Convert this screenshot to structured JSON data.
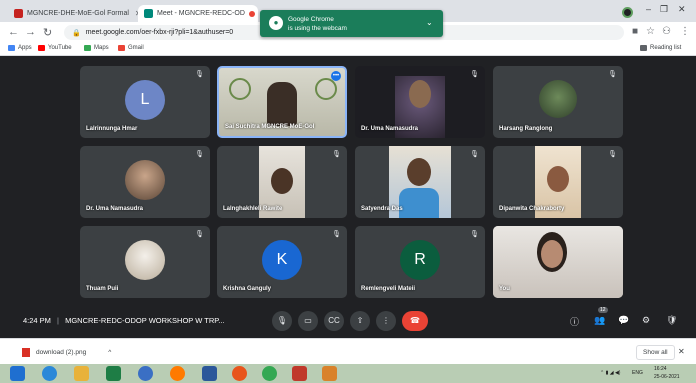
{
  "browser": {
    "tabs": [
      {
        "title": "MGNCRE-DHE-MoE-Gol Formal"
      },
      {
        "title": "Meet - MGNCRE-REDC-OD"
      },
      {
        "title": "+"
      }
    ],
    "url": "meet.google.com/oer-fxbx-rji?pli=1&authuser=0",
    "reading_list": "Reading list",
    "bookmarks": [
      "Apps",
      "YouTube",
      "Maps",
      "Gmail"
    ]
  },
  "notification": {
    "title": "Google Chrome",
    "text": "is using the webcam"
  },
  "participants": [
    {
      "name": "Lalrinnunga Hmar",
      "avatar_letter": "L"
    },
    {
      "name": "Sai Suchitra MGNCRE MoE-Gol"
    },
    {
      "name": "Dr. Uma Namasudra"
    },
    {
      "name": "Harsang Ranglong"
    },
    {
      "name": "Dr. Uma Namasudra"
    },
    {
      "name": "Lalnghakhleli Rawite"
    },
    {
      "name": "Satyendra Das"
    },
    {
      "name": "Dipanwita Chakraborty"
    },
    {
      "name": "Thuam Puii"
    },
    {
      "name": "Krishna Ganguly",
      "avatar_letter": "K"
    },
    {
      "name": "Remlengveli Mateii",
      "avatar_letter": "R"
    },
    {
      "name": "You"
    }
  ],
  "meeting": {
    "time": "4:24 PM",
    "title": "MGNCRE-REDC-ODOP WORKSHOP W TRP...",
    "participant_count": "12"
  },
  "download": {
    "filename": "download (2).png",
    "show_all": "Show all"
  },
  "taskbar": {
    "lang": "ENG",
    "time": "16:24",
    "date": "25-06-2021"
  },
  "colors": {
    "meet_bg": "#202124",
    "tile_bg": "#3c4043",
    "end_call": "#ea4335",
    "notification": "#1b7d5a",
    "avatar_l": "#6d86c6",
    "avatar_k": "#1967d2",
    "avatar_r": "#0b5d3e"
  }
}
